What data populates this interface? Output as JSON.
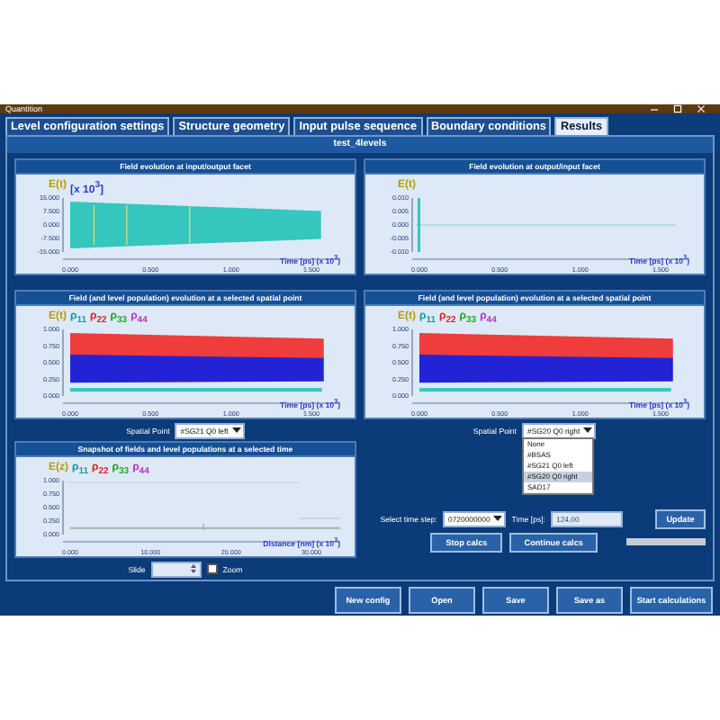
{
  "window": {
    "title": "Quantition"
  },
  "tabs": [
    {
      "label": "Level configuration settings",
      "selected": false
    },
    {
      "label": "Structure geometry",
      "selected": false
    },
    {
      "label": "Input pulse sequence",
      "selected": false
    },
    {
      "label": "Boundary conditions",
      "selected": false
    },
    {
      "label": "Results",
      "selected": true
    }
  ],
  "header": "test_4levels",
  "panels": [
    {
      "title": "Field evolution at input/output facet",
      "kind": "dense",
      "legend": [
        {
          "label": "E(t)",
          "color": "#b89a00"
        },
        {
          "label": "[x 10$^{3}$]",
          "color": "#2a3cc8"
        }
      ],
      "yticks": [
        "15.000",
        "7.500",
        "0.000",
        "-7.500",
        "-15.000"
      ],
      "xticks": [
        "0.000",
        "0.500",
        "1.000",
        "1.500"
      ],
      "xlabel": "Time [ps] (x 10$^{3}$)"
    },
    {
      "title": "Field evolution at output/input facet",
      "kind": "flat",
      "legend": [
        {
          "label": "E(t)",
          "color": "#b89a00"
        }
      ],
      "yticks": [
        "0.010",
        "0.005",
        "0.000",
        "-0.005",
        "-0.010"
      ],
      "xticks": [
        "0.000",
        "0.500",
        "1.000",
        "1.500"
      ],
      "xlabel": "Time [ps] (x 10$^{3}$)"
    },
    {
      "title": "Field (and level population) evolution at a selected spatial point",
      "kind": "bands",
      "legend": [
        {
          "label": "E(t)",
          "color": "#b89a00"
        },
        {
          "label": "ρ$_{11}$",
          "color": "#109a9a"
        },
        {
          "label": "ρ$_{22}$",
          "color": "#d82020"
        },
        {
          "label": "ρ$_{33}$",
          "color": "#20a020"
        },
        {
          "label": "ρ$_{44}$",
          "color": "#b830b8"
        }
      ],
      "yticks": [
        "1.000",
        "0.750",
        "0.500",
        "0.250",
        "0.000"
      ],
      "xticks": [
        "0.000",
        "0.500",
        "1.000",
        "1.500"
      ],
      "xlabel": "Time [ps] (x 10$^{3}$)"
    },
    {
      "title": "Field (and level population) evolution at a selected spatial point",
      "kind": "bands",
      "legend": [
        {
          "label": "E(t)",
          "color": "#b89a00"
        },
        {
          "label": "ρ$_{11}$",
          "color": "#109a9a"
        },
        {
          "label": "ρ$_{22}$",
          "color": "#d82020"
        },
        {
          "label": "ρ$_{33}$",
          "color": "#20a020"
        },
        {
          "label": "ρ$_{44}$",
          "color": "#b830b8"
        }
      ],
      "yticks": [
        "1.000",
        "0.750",
        "0.500",
        "0.250",
        "0.000"
      ],
      "xticks": [
        "0.000",
        "0.500",
        "1.000",
        "1.500"
      ],
      "xlabel": "Time [ps] (x 10$^{3}$)"
    },
    {
      "title": "Snapshot of fields and level populations at a selected time",
      "kind": "snapshot",
      "legend": [
        {
          "label": "E(z)",
          "color": "#b89a00"
        },
        {
          "label": "ρ$_{11}$",
          "color": "#109a9a"
        },
        {
          "label": "ρ$_{22}$",
          "color": "#d82020"
        },
        {
          "label": "ρ$_{33}$",
          "color": "#20a020"
        },
        {
          "label": "ρ$_{44}$",
          "color": "#b830b8"
        }
      ],
      "yticks": [
        "1.000",
        "0.750",
        "0.500",
        "0.250",
        "0.000"
      ],
      "xticks": [
        "0.000",
        "10.000",
        "20.000",
        "30.000"
      ],
      "xlabel": "Distance [nm] (x 10$^{3}$)"
    }
  ],
  "spatial_left": {
    "label": "Spatial Point",
    "value": "#SG21 Q0 left"
  },
  "spatial_right": {
    "label": "Spatial Point",
    "value": "#SG20 Q0 right",
    "options": [
      {
        "label": "None",
        "selected": false
      },
      {
        "label": "#BSAS",
        "selected": false
      },
      {
        "label": "#SG21 Q0 left",
        "selected": false
      },
      {
        "label": "#SG20 Q0 right",
        "selected": true
      },
      {
        "label": "SAD17",
        "selected": false
      }
    ]
  },
  "slide": {
    "label": "Slide",
    "zoom_label": "Zoom",
    "zoom_checked": false
  },
  "time_step": {
    "label": "Select time step:",
    "value": "0720000000",
    "time_label": "Time [ps]:",
    "time_value": "124.00",
    "update": "Update"
  },
  "calc_buttons": [
    "Stop calcs",
    "Continue calcs"
  ],
  "footer_buttons": [
    "New config",
    "Open",
    "Save",
    "Save as",
    "Start calculations"
  ]
}
